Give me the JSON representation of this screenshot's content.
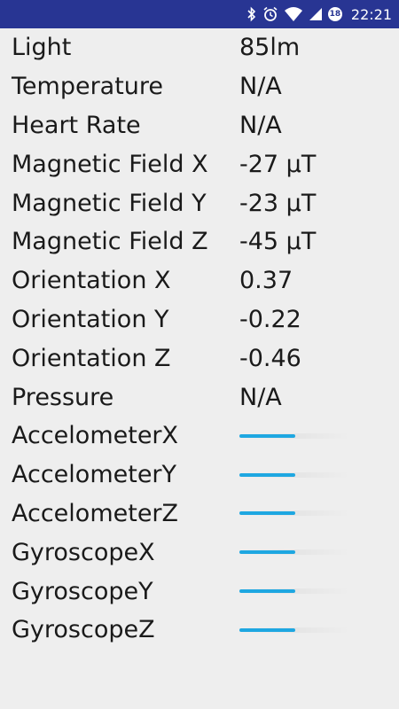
{
  "status_bar": {
    "icons": [
      "bluetooth-icon",
      "alarm-icon",
      "wifi-icon",
      "signal-icon",
      "battery-icon"
    ],
    "badge": "18",
    "time": "22:21"
  },
  "sensors": [
    {
      "label": "Light",
      "value": "85lm"
    },
    {
      "label": "Temperature",
      "value": "N/A"
    },
    {
      "label": "Heart Rate",
      "value": "N/A"
    },
    {
      "label": "Magnetic Field X",
      "value": "-27 µT"
    },
    {
      "label": "Magnetic Field Y",
      "value": "-23 µT"
    },
    {
      "label": "Magnetic Field Z",
      "value": "-45 µT"
    },
    {
      "label": "Orientation X",
      "value": "0.37"
    },
    {
      "label": "Orientation Y",
      "value": "-0.22"
    },
    {
      "label": "Orientation Z",
      "value": "-0.46"
    },
    {
      "label": "Pressure",
      "value": "N/A"
    }
  ],
  "motion_sensors": [
    {
      "label": "AccelometerX",
      "level": 0.5
    },
    {
      "label": "AccelometerY",
      "level": 0.5
    },
    {
      "label": "AccelometerZ",
      "level": 0.5
    },
    {
      "label": "GyroscopeX",
      "level": 0.5
    },
    {
      "label": "GyroscopeY",
      "level": 0.5
    },
    {
      "label": "GyroscopeZ",
      "level": 0.5
    }
  ],
  "colors": {
    "status_bar": "#283593",
    "background": "#eeeeee",
    "bar_fill": "#1ea7e1"
  }
}
